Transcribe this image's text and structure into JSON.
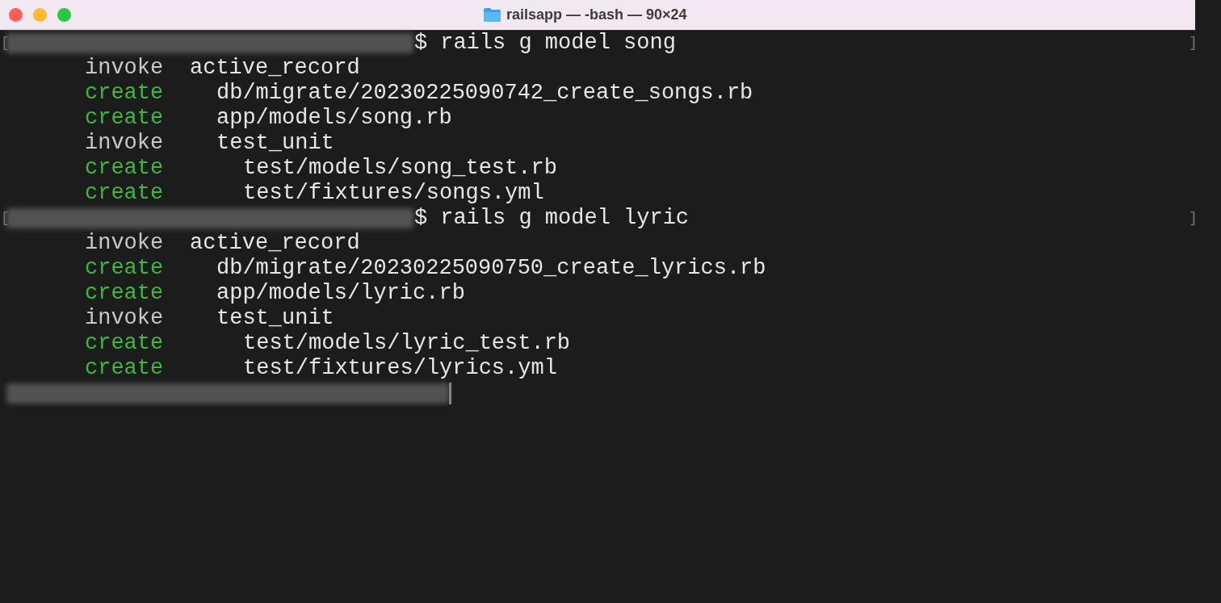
{
  "window": {
    "title": "railsapp — -bash — 90×24"
  },
  "lines": [
    {
      "kind": "prompt",
      "bracket_left": "[",
      "dollar": "$",
      "command": "rails g model song",
      "bracket_right": "]",
      "output": [
        {
          "action": "invoke",
          "color": "#c8c8c8",
          "path": "active_record",
          "children": [
            {
              "action": "create",
              "color": "#3cb83c",
              "path": "db/migrate/20230225090742_create_songs.rb"
            },
            {
              "action": "create",
              "color": "#3cb83c",
              "path": "app/models/song.rb"
            },
            {
              "action": "invoke",
              "color": "#c8c8c8",
              "path": "test_unit",
              "children": [
                {
                  "action": "create",
                  "color": "#3cb83c",
                  "path": "test/models/song_test.rb"
                },
                {
                  "action": "create",
                  "color": "#3cb83c",
                  "path": "test/fixtures/songs.yml"
                }
              ]
            }
          ]
        }
      ]
    },
    {
      "kind": "prompt",
      "bracket_left": "[",
      "dollar": "$",
      "command": "rails g model lyric",
      "bracket_right": "]",
      "output": [
        {
          "action": "invoke",
          "color": "#c8c8c8",
          "path": "active_record",
          "children": [
            {
              "action": "create",
              "color": "#3cb83c",
              "path": "db/migrate/20230225090750_create_lyrics.rb"
            },
            {
              "action": "create",
              "color": "#3cb83c",
              "path": "app/models/lyric.rb"
            },
            {
              "action": "invoke",
              "color": "#c8c8c8",
              "path": "test_unit",
              "children": [
                {
                  "action": "create",
                  "color": "#3cb83c",
                  "path": "test/models/lyric_test.rb"
                },
                {
                  "action": "create",
                  "color": "#3cb83c",
                  "path": "test/fixtures/lyrics.yml"
                }
              ]
            }
          ]
        }
      ]
    },
    {
      "kind": "cursor"
    }
  ]
}
